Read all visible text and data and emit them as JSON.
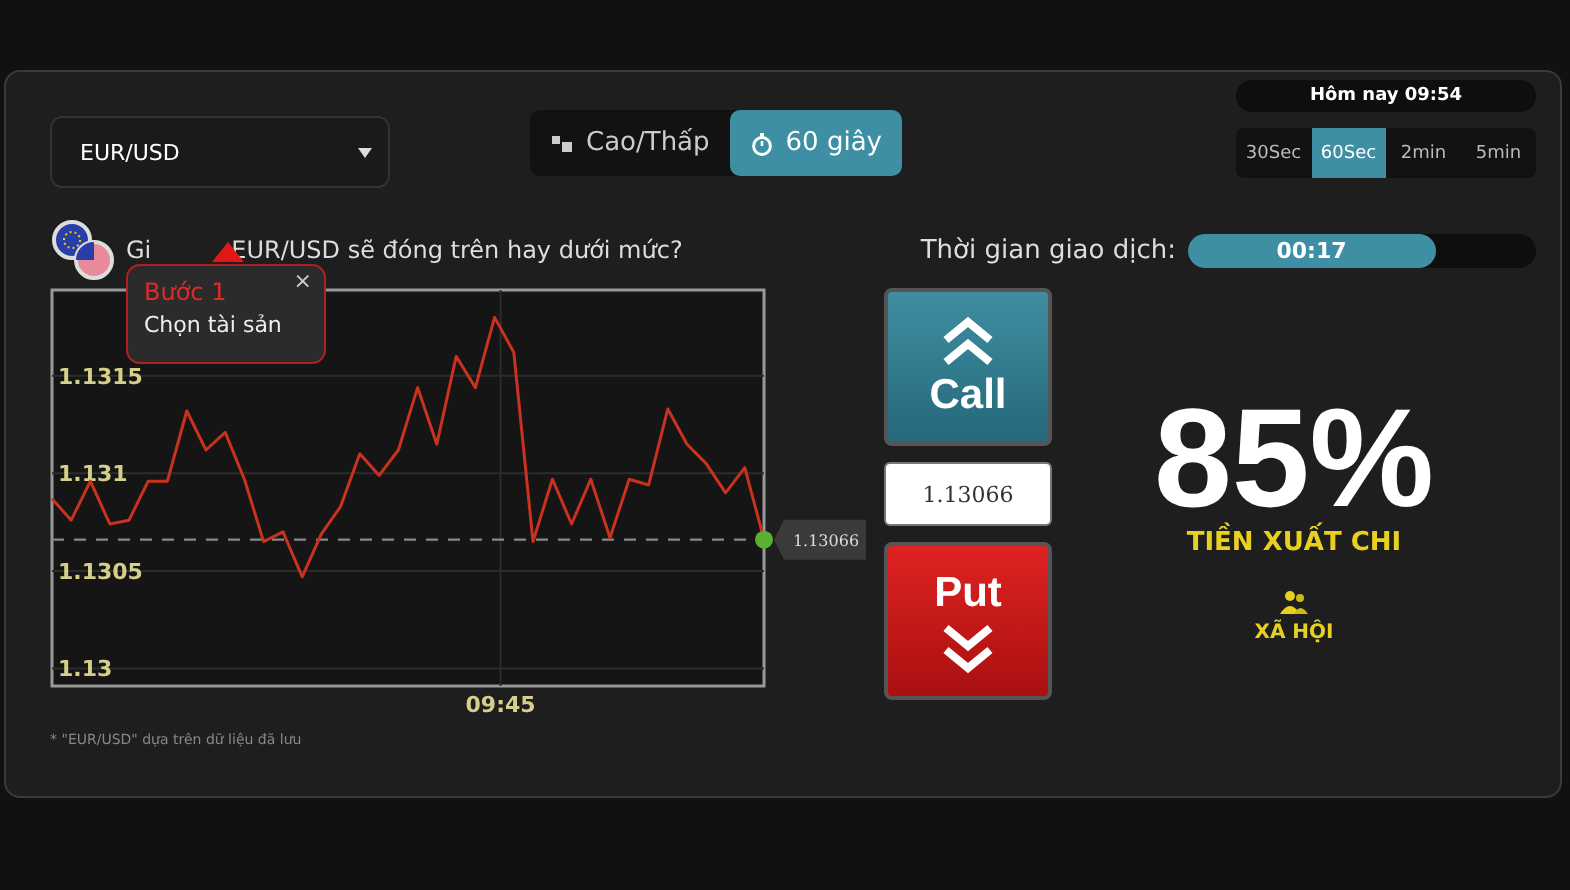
{
  "asset_select": {
    "value": "EUR/USD"
  },
  "modes": [
    {
      "label": "Cao/Thấp",
      "selected": false,
      "kind": "highlow"
    },
    {
      "label": "60 giây",
      "selected": true,
      "kind": "timer"
    }
  ],
  "clock": "Hôm nay 09:54",
  "durations": [
    {
      "label": "30Sec",
      "selected": false
    },
    {
      "label": "60Sec",
      "selected": true
    },
    {
      "label": "2min",
      "selected": false
    },
    {
      "label": "5min",
      "selected": false
    }
  ],
  "question": {
    "before": "Gi",
    "after": "EUR/USD sẽ đóng trên hay dưới mức?"
  },
  "tooltip": {
    "title": "Bước 1",
    "text": "Chọn tài sản",
    "close": "×"
  },
  "trade_time": {
    "label": "Thời gian giao dịch:",
    "value": "00:17",
    "level": 0.71
  },
  "chart": {
    "price_tag": "1.13066",
    "chart_data": {
      "type": "line",
      "ylim": [
        1.12991,
        1.13194
      ],
      "yticks": [
        1.13,
        1.1305,
        1.131,
        1.1315
      ],
      "grid": true,
      "annotations": [
        "09:45"
      ],
      "series": [
        {
          "color": "#c8321e",
          "values": [
            1.13087,
            1.13076,
            1.13096,
            1.13074,
            1.13076,
            1.13096,
            1.13096,
            1.13132,
            1.13112,
            1.13121,
            1.13097,
            1.13065,
            1.1307,
            1.13047,
            1.13069,
            1.13083,
            1.1311,
            1.13099,
            1.13112,
            1.13144,
            1.13115,
            1.1316,
            1.13144,
            1.1318,
            1.13162,
            1.13065,
            1.13097,
            1.13074,
            1.13097,
            1.13067,
            1.13097,
            1.13094,
            1.13133,
            1.13115,
            1.13105,
            1.1309,
            1.13103,
            1.13066
          ]
        },
        {
          "color": "#888888",
          "line_style": "dashed",
          "values": [
            1.13066,
            1.13066,
            1.13066,
            1.13066,
            1.13066,
            1.13066,
            1.13066,
            1.13066,
            1.13066,
            1.13066,
            1.13066,
            1.13066,
            1.13066,
            1.13066,
            1.13066,
            1.13066,
            1.13066,
            1.13066,
            1.13066,
            1.13066,
            1.13066,
            1.13066,
            1.13066,
            1.13066,
            1.13066,
            1.13066,
            1.13066,
            1.13066,
            1.13066,
            1.13066,
            1.13066,
            1.13066,
            1.13066,
            1.13066,
            1.13066,
            1.13066,
            1.13066,
            1.13066
          ]
        }
      ]
    }
  },
  "actions": [
    {
      "label": "Call",
      "kind": "call"
    },
    {
      "label": "Put",
      "kind": "put"
    }
  ],
  "strike_field": {
    "value": "1.13066"
  },
  "payout": {
    "value": "85%",
    "label": "TIỀN XUẤT CHI"
  },
  "social": {
    "label": "XÃ HỘI"
  },
  "footnote": "* \"EUR/USD\" dựa trên dữ liệu đã lưu"
}
